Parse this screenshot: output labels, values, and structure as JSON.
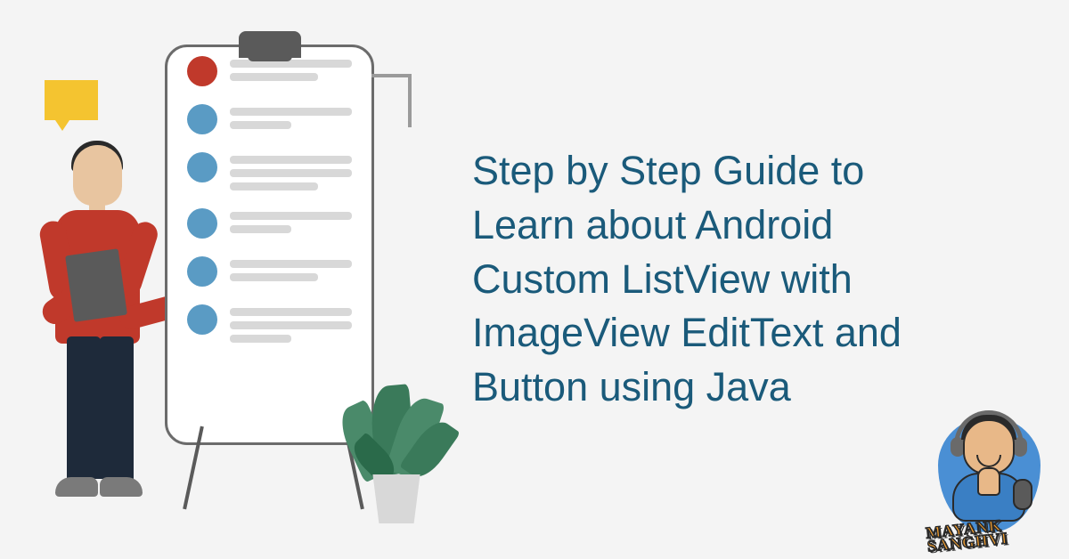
{
  "title": "Step by Step Guide to Learn about Android Custom ListView with ImageView EditText and Button using Java",
  "logo": {
    "name_line1": "MAYANK",
    "name_line2": "SANGHVI"
  },
  "colors": {
    "title_color": "#1a5a7a",
    "accent_yellow": "#f4c430",
    "accent_red": "#c0392b",
    "accent_blue": "#5a9bc4",
    "background": "#f4f4f4"
  },
  "whiteboard": {
    "items": [
      {
        "bullet_color": "red",
        "line_count": 2
      },
      {
        "bullet_color": "blue",
        "line_count": 2
      },
      {
        "bullet_color": "blue",
        "line_count": 3
      },
      {
        "bullet_color": "blue",
        "line_count": 2
      },
      {
        "bullet_color": "blue",
        "line_count": 2
      },
      {
        "bullet_color": "blue",
        "line_count": 3
      }
    ]
  }
}
